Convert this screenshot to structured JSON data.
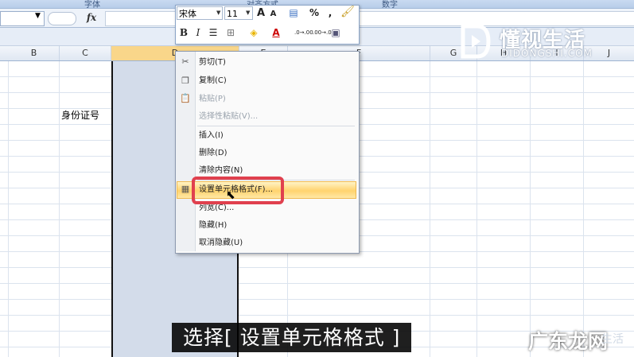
{
  "ribbon": {
    "group_font": "字体",
    "group_align": "对齐方式",
    "group_number": "数字"
  },
  "formula_bar": {
    "fx_label": "fx",
    "name_box_value": ""
  },
  "columns": [
    "B",
    "C",
    "D",
    "E",
    "F",
    "G",
    "H",
    "I",
    "J"
  ],
  "cell_label": "身份证号",
  "mini_toolbar": {
    "font_name": "宋体",
    "font_size": "11",
    "grow_font": "A",
    "shrink_font": "A",
    "percent": "%",
    "comma": ",",
    "bold": "B",
    "italic": "I",
    "font_color": "A",
    "increase_decimal": ".0→.00",
    "decrease_decimal": ".00→.0"
  },
  "context_menu": {
    "items": [
      {
        "label": "剪切(T)",
        "icon": "scissors-icon",
        "disabled": false
      },
      {
        "label": "复制(C)",
        "icon": "copy-icon",
        "disabled": false
      },
      {
        "label": "粘贴(P)",
        "icon": "paste-icon",
        "disabled": true
      },
      {
        "label": "选择性粘贴(V)...",
        "icon": "",
        "disabled": true
      },
      {
        "label": "插入(I)",
        "icon": "",
        "disabled": false
      },
      {
        "label": "删除(D)",
        "icon": "",
        "disabled": false
      },
      {
        "label": "清除内容(N)",
        "icon": "",
        "disabled": false
      },
      {
        "label": "设置单元格格式(F)...",
        "icon": "format-cells-icon",
        "disabled": false,
        "highlighted": true
      },
      {
        "label": "列宽(C)...",
        "icon": "",
        "disabled": false
      },
      {
        "label": "隐藏(H)",
        "icon": "",
        "disabled": false
      },
      {
        "label": "取消隐藏(U)",
        "icon": "",
        "disabled": false
      }
    ]
  },
  "watermark": {
    "title": "懂视生活",
    "subtitle": "DIDONGSHI.COM"
  },
  "subtitle_text": "选择[ 设置单元格格式 ]",
  "brand": {
    "name": "广东龙网",
    "faint": "生活"
  },
  "colors": {
    "selection": "#d3dcea",
    "highlight": "#ffd36e",
    "annotation": "#e0404e",
    "ribbon": "#c9daf1"
  }
}
